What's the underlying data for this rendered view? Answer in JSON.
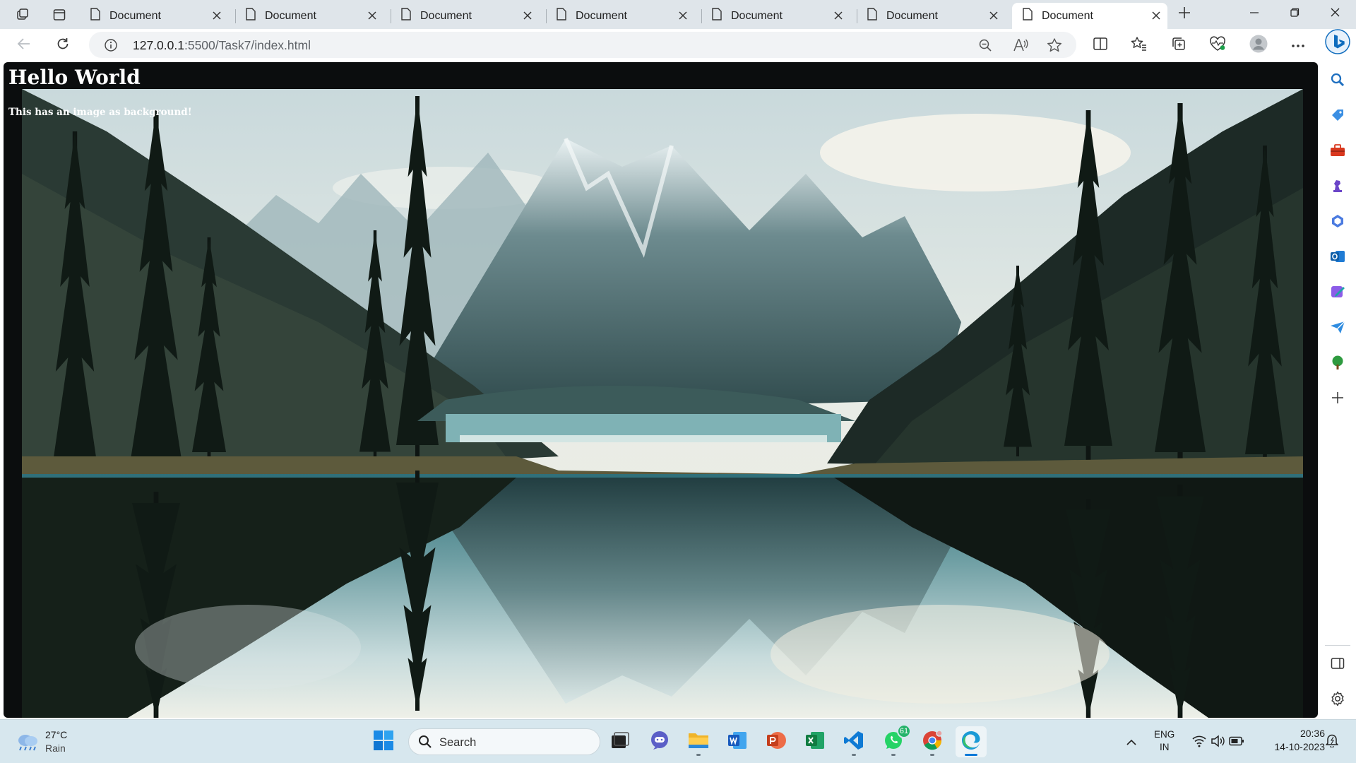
{
  "browser": {
    "tabs": [
      {
        "title": "Document",
        "active": false
      },
      {
        "title": "Document",
        "active": false
      },
      {
        "title": "Document",
        "active": false
      },
      {
        "title": "Document",
        "active": false
      },
      {
        "title": "Document",
        "active": false
      },
      {
        "title": "Document",
        "active": false
      },
      {
        "title": "Document",
        "active": true
      }
    ],
    "address": {
      "host": "127.0.0.1",
      "path": ":5500/Task7/index.html"
    },
    "accent": "#0f6cbd"
  },
  "page": {
    "heading": "Hello World",
    "paragraph": "This has an image as background!",
    "background_color": "#0b0d0e"
  },
  "sidebar": {
    "items": [
      "search-icon",
      "tag-icon",
      "toolbox-icon",
      "chess-icon",
      "copilot-icon",
      "outlook-icon",
      "designer-icon",
      "send-icon",
      "tree-icon",
      "add-icon",
      "split-icon",
      "settings-icon"
    ]
  },
  "taskbar": {
    "weather": {
      "temp": "27°C",
      "condition": "Rain"
    },
    "search_label": "Search",
    "apps": [
      "start",
      "search",
      "task-view",
      "teams",
      "file-explorer",
      "word",
      "powerpoint",
      "excel",
      "vscode",
      "whatsapp",
      "chrome",
      "edge"
    ],
    "whatsapp_badge": "61",
    "language": {
      "line1": "ENG",
      "line2": "IN"
    },
    "time": "20:36",
    "date": "14-10-2023"
  }
}
